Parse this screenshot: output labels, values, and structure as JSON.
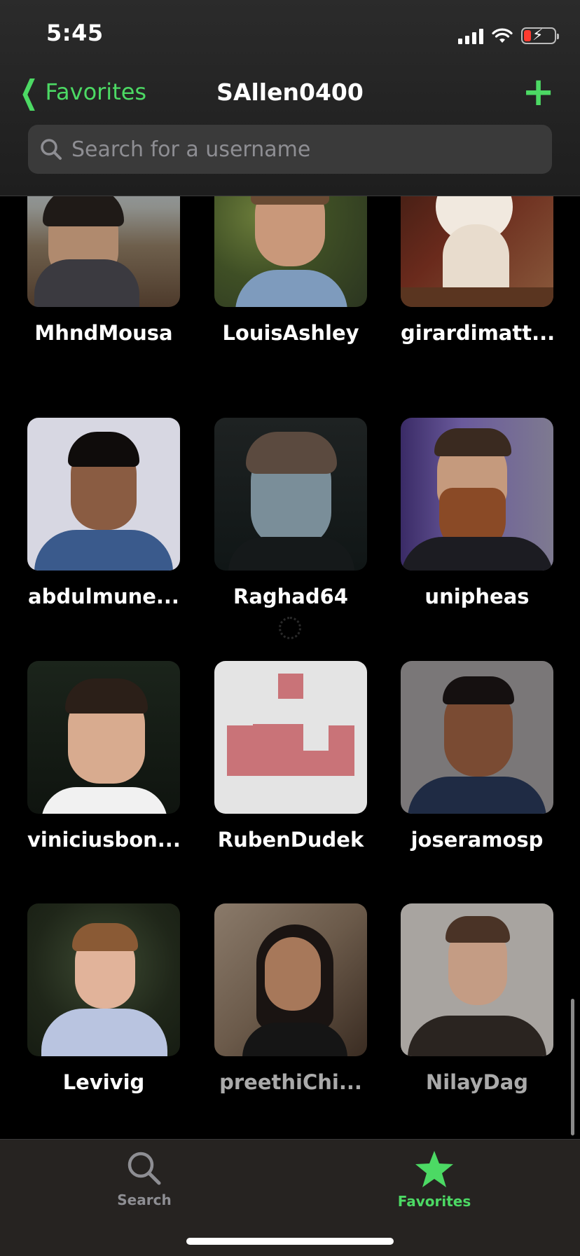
{
  "status_bar": {
    "time": "5:45"
  },
  "nav": {
    "back_label": "Favorites",
    "title": "SAllen0400",
    "add_label": "+"
  },
  "search": {
    "placeholder": "Search for a username",
    "value": ""
  },
  "favorites": [
    {
      "username": "MhndMousa"
    },
    {
      "username": "LouisAshley"
    },
    {
      "username": "girardimatt..."
    },
    {
      "username": "abdulmune..."
    },
    {
      "username": "Raghad64"
    },
    {
      "username": "unipheas"
    },
    {
      "username": "viniciusbon..."
    },
    {
      "username": "RubenDudek"
    },
    {
      "username": "joseramosp"
    },
    {
      "username": "Levivig"
    },
    {
      "username": "preethiChi..."
    },
    {
      "username": "NilayDag"
    }
  ],
  "tabs": [
    {
      "label": "Search",
      "icon": "search-icon",
      "active": false
    },
    {
      "label": "Favorites",
      "icon": "star-icon",
      "active": true
    }
  ],
  "colors": {
    "accent": "#4cd964",
    "inactive_tab": "#8e8e93",
    "battery_low": "#ff3b30"
  }
}
